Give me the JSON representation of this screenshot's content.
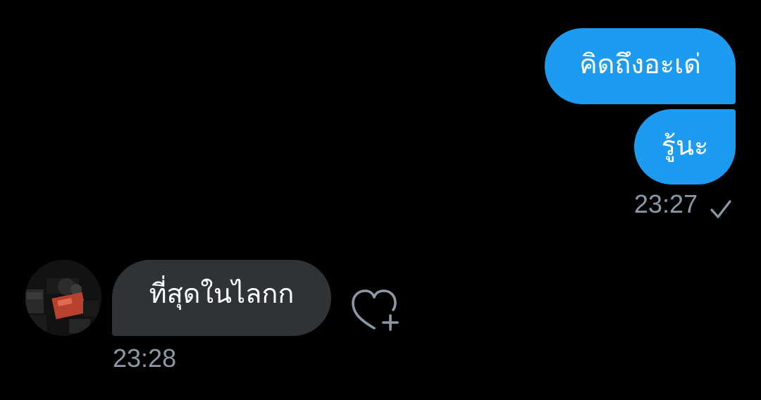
{
  "conversation": {
    "sent_messages": [
      {
        "text": "คิดถึงอะเด่"
      },
      {
        "text": "รู้นะ"
      }
    ],
    "sent_timestamp": "23:27",
    "sent_status_icon": "checkmark-icon",
    "received_messages": [
      {
        "text": "ที่สุดในไลกก"
      }
    ],
    "received_timestamp": "23:28",
    "reaction_icon": "heart-plus-icon"
  },
  "colors": {
    "background": "#000000",
    "sent_bubble": "#1d9bf0",
    "received_bubble": "#2f3336",
    "timestamp": "#8b98a5",
    "message_text": "#ffffff"
  }
}
